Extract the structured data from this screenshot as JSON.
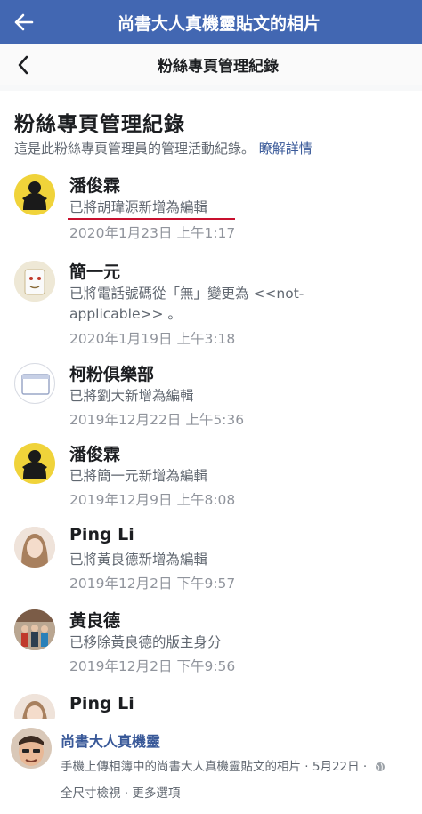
{
  "topbar": {
    "title": "尚書大人真機靈貼文的相片"
  },
  "screenshot": {
    "header_title": "粉絲專頁管理紀錄",
    "heading": "粉絲專頁管理紀錄",
    "description": "這是此粉絲專頁管理員的管理活動紀錄。",
    "learn_more": "瞭解詳情",
    "entries": [
      {
        "name": "潘俊霖",
        "action": "已將胡瑋源新增為編輯",
        "time": "2020年1月23日 上午1:17"
      },
      {
        "name": "簡一元",
        "action": "已將電話號碼從「無」變更為 <<not-applicable>> 。",
        "time": "2020年1月19日 上午3:18"
      },
      {
        "name": "柯粉俱樂部",
        "action": "已將劉大新增為編輯",
        "time": "2019年12月22日 上午5:36"
      },
      {
        "name": "潘俊霖",
        "action": "已將簡一元新增為編輯",
        "time": "2019年12月9日 上午8:08"
      },
      {
        "name": "Ping Li",
        "action": "已將黃良德新增為編輯",
        "time": "2019年12月2日 下午9:57"
      },
      {
        "name": "黃良德",
        "action": "已移除黃良德的版主身分",
        "time": "2019年12月2日 下午9:56"
      },
      {
        "name": "Ping Li"
      }
    ]
  },
  "footer": {
    "poster": "尚書大人真機靈",
    "meta": "手機上傳相簿中的尚書大人真機靈貼文的相片 · 5月22日 ·",
    "links": "全尺寸檢視 · 更多選項"
  },
  "colors": {
    "topbar": "#4267b2",
    "link": "#385898",
    "underline": "#c8102e"
  }
}
